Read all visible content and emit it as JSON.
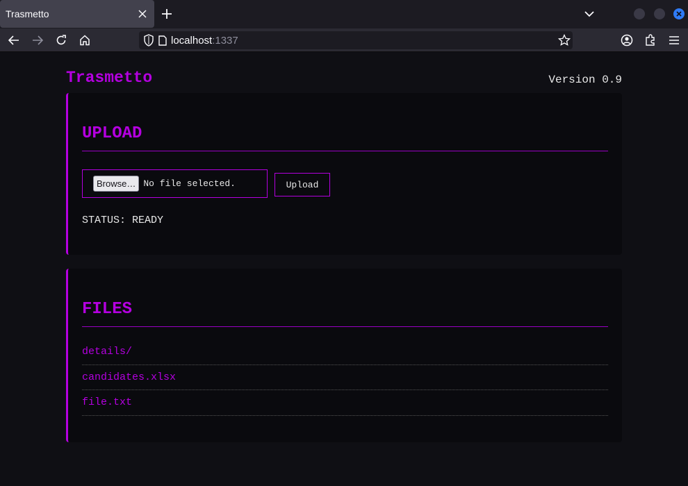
{
  "browser": {
    "tab_title": "Trasmetto",
    "url_host": "localhost",
    "url_port": ":1337"
  },
  "app": {
    "title": "Trasmetto",
    "version": "Version 0.9"
  },
  "upload": {
    "heading": "UPLOAD",
    "browse_label": "Browse…",
    "file_label": "No file selected.",
    "upload_label": "Upload",
    "status": "STATUS: READY"
  },
  "files": {
    "heading": "FILES",
    "items": [
      {
        "name": "details/"
      },
      {
        "name": "candidates.xlsx"
      },
      {
        "name": "file.txt"
      }
    ]
  },
  "colors": {
    "accent": "#b400e0",
    "background": "#0f0f14",
    "card": "#0a0a0e"
  }
}
